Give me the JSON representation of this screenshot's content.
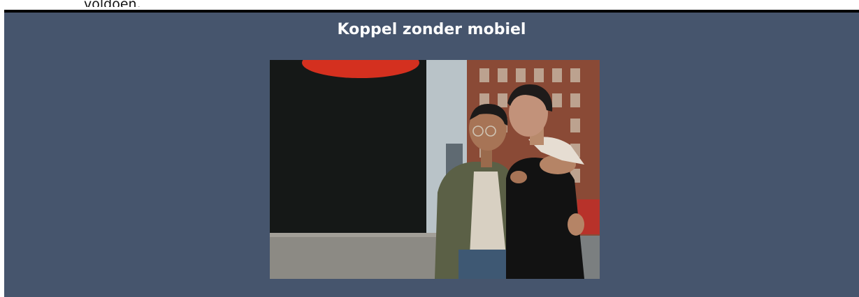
{
  "previous_section": {
    "text": "voldoen."
  },
  "card": {
    "title": "Koppel zonder mobiel",
    "background_color": "#46556d",
    "border_color": "#000000"
  },
  "photo": {
    "description_icon": "photo-of-couple-on-rooftop"
  }
}
